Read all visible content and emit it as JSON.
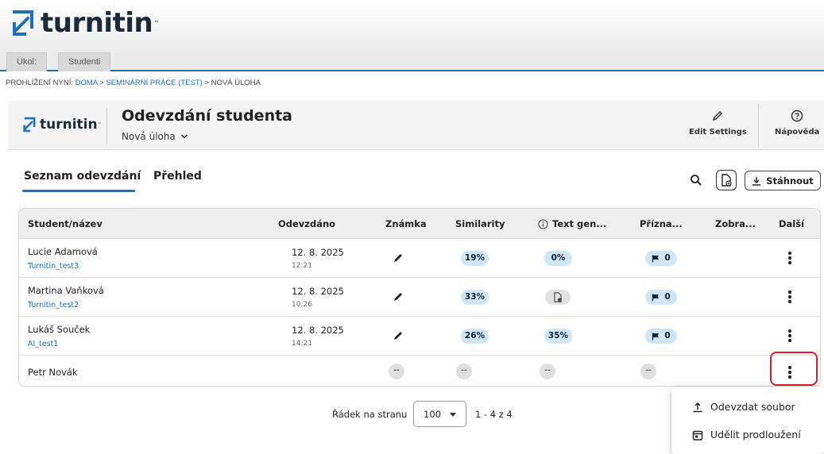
{
  "brand": {
    "name": "turnitin",
    "accent": "#1d6fb8",
    "alert": "#e01e25"
  },
  "tabs": [
    {
      "label": "Úkol:"
    },
    {
      "label": "Studenti"
    }
  ],
  "breadcrumb": {
    "prefix": "PROHLÍŽENÍ NYNÍ: ",
    "links": [
      "DOMA",
      "SEMINÁRNÍ PRÁCE (TEST)"
    ],
    "current": "NOVÁ ÚLOHA",
    "sep": " > "
  },
  "header": {
    "title": "Odevzdání studenta",
    "assignment": "Nová úloha",
    "edit_settings": "Edit Settings",
    "help": "Nápověda"
  },
  "section_tabs": [
    {
      "label": "Seznam odevzdání",
      "active": true
    },
    {
      "label": "Přehled",
      "active": false
    }
  ],
  "toolbar": {
    "download": "Stáhnout",
    "search_icon": "search-icon",
    "file_icon": "upload-file-icon"
  },
  "table": {
    "columns": [
      "Student/název",
      "Odevzdáno",
      "Známka",
      "Similarity",
      "Text gen...",
      "Přízna...",
      "Zobra...",
      "Další"
    ],
    "rows": [
      {
        "name": "Lucie Adamová",
        "file": "Turnitin_test3",
        "date": "12. 8. 2025",
        "time": "12:21",
        "similarity": "19%",
        "ai": "0%",
        "flags": "0"
      },
      {
        "name": "Martina Vaňková",
        "file": "Turnitin_test2",
        "date": "12. 8. 2025",
        "time": "10:26",
        "similarity": "33%",
        "ai": "",
        "flags": "0"
      },
      {
        "name": "Lukáš Souček",
        "file": "AI_test1",
        "date": "12. 8. 2025",
        "time": "14:21",
        "similarity": "26%",
        "ai": "35%",
        "flags": "0"
      },
      {
        "name": "Petr Novák",
        "file": "",
        "date": "",
        "time": "",
        "similarity": "--",
        "ai": "--",
        "flags": "--",
        "grade": "--"
      }
    ]
  },
  "pagination": {
    "label": "Řádek na stranu",
    "per_page": "100",
    "range": "1 - 4 z 4"
  },
  "menu": {
    "items": [
      "Odevzdat soubor",
      "Udělit prodloužení"
    ]
  }
}
